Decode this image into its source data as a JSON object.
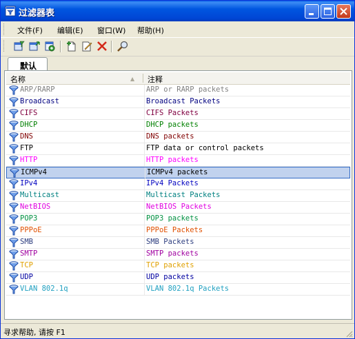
{
  "window": {
    "title": "过滤器表",
    "title_icon": "filter-table-app-icon",
    "controls": [
      "minimize",
      "maximize",
      "close"
    ],
    "titlebar_color": "#0054e3"
  },
  "menu": [
    {
      "label": "文件(F)"
    },
    {
      "label": "编辑(E)"
    },
    {
      "label": "窗口(W)"
    },
    {
      "label": "帮助(H)"
    }
  ],
  "toolbar": {
    "buttons": [
      "open-filter-icon",
      "save-filter-icon",
      "import-filter-icon",
      "new-filter-icon",
      "edit-filter-icon",
      "delete-icon",
      "find-icon"
    ]
  },
  "tabs": [
    {
      "label": "默认",
      "selected": true
    }
  ],
  "table": {
    "columns": [
      "名称",
      "注释"
    ],
    "sorted_column": "名称",
    "rows": [
      {
        "name": "ARP/RARP",
        "note": "ARP or RARP packets",
        "color": "#808080"
      },
      {
        "name": "Broadcast",
        "note": "Broadcast Packets",
        "color": "#000080"
      },
      {
        "name": "CIFS",
        "note": "CIFS Packets",
        "color": "#800040"
      },
      {
        "name": "DHCP",
        "note": "DHCP packets",
        "color": "#008000"
      },
      {
        "name": "DNS",
        "note": "DNS packets",
        "color": "#800000"
      },
      {
        "name": "FTP",
        "note": "FTP data or control packets",
        "color": "#000000"
      },
      {
        "name": "HTTP",
        "note": "HTTP  packets",
        "color": "#ff00ff"
      },
      {
        "name": "ICMPv4",
        "note": "ICMPv4 packets",
        "color": "#000000",
        "selected": true
      },
      {
        "name": "IPv4",
        "note": "IPv4 Packets",
        "color": "#0000c0"
      },
      {
        "name": "Multicast",
        "note": "Multicast Packets",
        "color": "#008080"
      },
      {
        "name": "NetBIOS",
        "note": "NetBIOS Packets",
        "color": "#e000e0"
      },
      {
        "name": "POP3",
        "note": "POP3 packets",
        "color": "#009040"
      },
      {
        "name": "PPPoE",
        "note": "PPPoE Packets",
        "color": "#e05000"
      },
      {
        "name": "SMB",
        "note": "SMB Packets",
        "color": "#304080"
      },
      {
        "name": "SMTP",
        "note": "SMTP packets",
        "color": "#a000a0"
      },
      {
        "name": "TCP",
        "note": "TCP packets",
        "color": "#e0a000"
      },
      {
        "name": "UDP",
        "note": "UDP packets",
        "color": "#0000a0"
      },
      {
        "name": "VLAN 802.1q",
        "note": "VLAN 802.1q Packets",
        "color": "#20a0c0"
      }
    ]
  },
  "status": {
    "text": "寻求帮助, 请按 F1"
  }
}
